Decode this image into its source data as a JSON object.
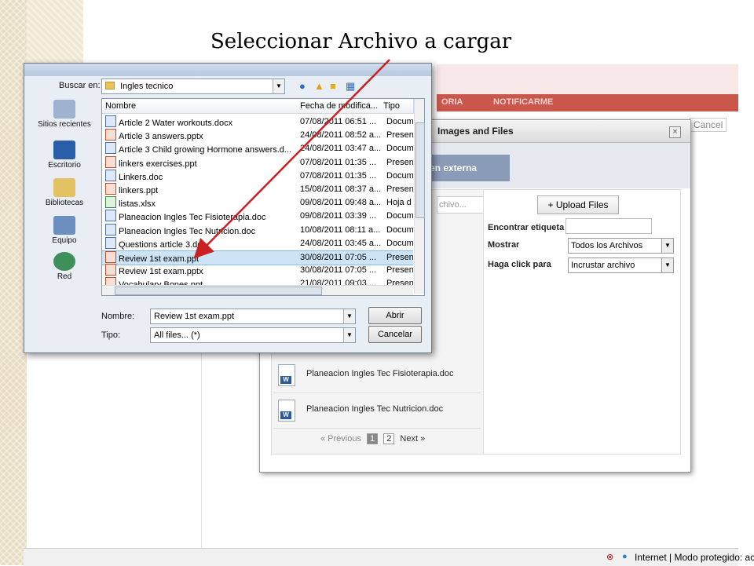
{
  "slide_title": "Seleccionar Archivo a cargar",
  "background_page": {
    "cancel_label": "Cancel",
    "ghost_nav": [
      "ORIA",
      "NOTIFICARME"
    ]
  },
  "files_dialog": {
    "title": "Images and Files",
    "tab_label": "en externa",
    "search_placeholder": "chivo...",
    "upload_label": "Upload Files",
    "find_tag_label": "Encontrar etiqueta",
    "show_label": "Mostrar",
    "show_value": "Todos los Archivos",
    "click_label": "Haga click para",
    "click_value": "Incrustar archivo",
    "files": [
      "Planeacion Ingles Tec Fisioterapia.doc",
      "Planeacion Ingles Tec Nutricion.doc"
    ],
    "pager": {
      "previous": "« Previous",
      "pages": [
        "1",
        "2"
      ],
      "next": "Next »"
    }
  },
  "open_dialog": {
    "look_in_label": "Buscar en:",
    "look_in_value": "Ingles tecnico",
    "places": [
      "Sitios recientes",
      "Escritorio",
      "Bibliotecas",
      "Equipo",
      "Red"
    ],
    "columns": [
      "Nombre",
      "Fecha de modifica...",
      "Tipo"
    ],
    "rows": [
      {
        "name": "Article 2 Water workouts.docx",
        "date": "07/08/2011 06:51 ...",
        "type": "Docum",
        "kind": "w"
      },
      {
        "name": "Article 3 answers.pptx",
        "date": "24/08/2011 08:52 a...",
        "type": "Presen",
        "kind": "p"
      },
      {
        "name": "Article 3 Child growing Hormone answers.d...",
        "date": "24/08/2011 03:47 a...",
        "type": "Docum",
        "kind": "w"
      },
      {
        "name": "linkers exercises.ppt",
        "date": "07/08/2011 01:35 ...",
        "type": "Presen",
        "kind": "p"
      },
      {
        "name": "Linkers.doc",
        "date": "07/08/2011 01:35 ...",
        "type": "Docum",
        "kind": "w"
      },
      {
        "name": "linkers.ppt",
        "date": "15/08/2011 08:37 a...",
        "type": "Presen",
        "kind": "p"
      },
      {
        "name": "listas.xlsx",
        "date": "09/08/2011 09:48 a...",
        "type": "Hoja d",
        "kind": "x"
      },
      {
        "name": "Planeacion Ingles Tec Fisioterapia.doc",
        "date": "09/08/2011 03:39 ...",
        "type": "Docum",
        "kind": "w"
      },
      {
        "name": "Planeacion Ingles Tec Nutricion.doc",
        "date": "10/08/2011 08:11 a...",
        "type": "Docum",
        "kind": "w"
      },
      {
        "name": "Questions article 3.doc",
        "date": "24/08/2011 03:45 a...",
        "type": "Docum",
        "kind": "w"
      },
      {
        "name": "Review 1st exam.ppt",
        "date": "30/08/2011 07:05 ...",
        "type": "Presen",
        "kind": "p",
        "selected": true
      },
      {
        "name": "Review 1st exam.pptx",
        "date": "30/08/2011 07:05 ...",
        "type": "Presen",
        "kind": "p"
      },
      {
        "name": "Vocabulary Bones.ppt",
        "date": "21/08/2011 09:03 ...",
        "type": "Presen",
        "kind": "p"
      }
    ],
    "filename_label": "Nombre:",
    "filename_value": "Review 1st exam.ppt",
    "filetype_label": "Tipo:",
    "filetype_value": "All files... (*)",
    "open_button": "Abrir",
    "cancel_button": "Cancelar"
  },
  "statusbar": {
    "text": "Internet | Modo protegido: activad"
  },
  "colors": {
    "arrow": "#cc1f1f",
    "selection": "#cde4f7",
    "accent": "#8a9bb8"
  }
}
